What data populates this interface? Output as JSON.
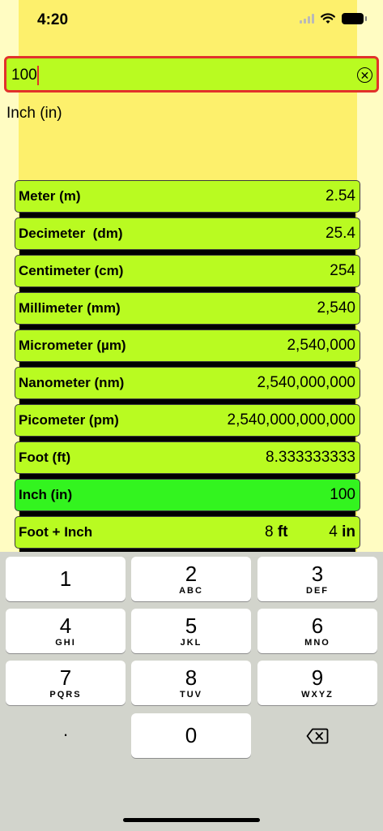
{
  "status": {
    "time": "4:20"
  },
  "input": {
    "value": "100",
    "placeholder": ""
  },
  "unit_label": "Inch (in)",
  "rows": [
    {
      "label": "Meter (m)",
      "value": "2.54",
      "active": false
    },
    {
      "label": "Decimeter  (dm)",
      "value": "25.4",
      "active": false
    },
    {
      "label": "Centimeter (cm)",
      "value": "254",
      "active": false
    },
    {
      "label": "Millimeter (mm)",
      "value": "2,540",
      "active": false
    },
    {
      "label": "Micrometer (µm)",
      "value": "2,540,000",
      "active": false
    },
    {
      "label": "Nanometer (nm)",
      "value": "2,540,000,000",
      "active": false
    },
    {
      "label": "Picometer (pm)",
      "value": "2,540,000,000,000",
      "active": false
    },
    {
      "label": "Foot (ft)",
      "value": "8.333333333",
      "active": false
    },
    {
      "label": "Inch (in)",
      "value": "100",
      "active": true
    }
  ],
  "foot_inch": {
    "label": "Foot + Inch",
    "ft_value": "8",
    "ft_unit": "ft",
    "in_value": "4",
    "in_unit": "in"
  },
  "keyboard": {
    "keys": [
      {
        "num": "1",
        "letters": ""
      },
      {
        "num": "2",
        "letters": "ABC"
      },
      {
        "num": "3",
        "letters": "DEF"
      },
      {
        "num": "4",
        "letters": "GHI"
      },
      {
        "num": "5",
        "letters": "JKL"
      },
      {
        "num": "6",
        "letters": "MNO"
      },
      {
        "num": "7",
        "letters": "PQRS"
      },
      {
        "num": "8",
        "letters": "TUV"
      },
      {
        "num": "9",
        "letters": "WXYZ"
      },
      {
        "num": "0",
        "letters": ""
      }
    ],
    "dot": ".",
    "icons": {
      "delete": "backspace-icon",
      "clear": "clear-circle-icon"
    }
  },
  "colors": {
    "row_bg": "#b9fb21",
    "active_row_bg": "#33f41f",
    "input_border": "#e2312b",
    "page_bg": "#fffcc2",
    "band_bg": "#fdf06c",
    "keyboard_bg": "#d2d4cc"
  }
}
